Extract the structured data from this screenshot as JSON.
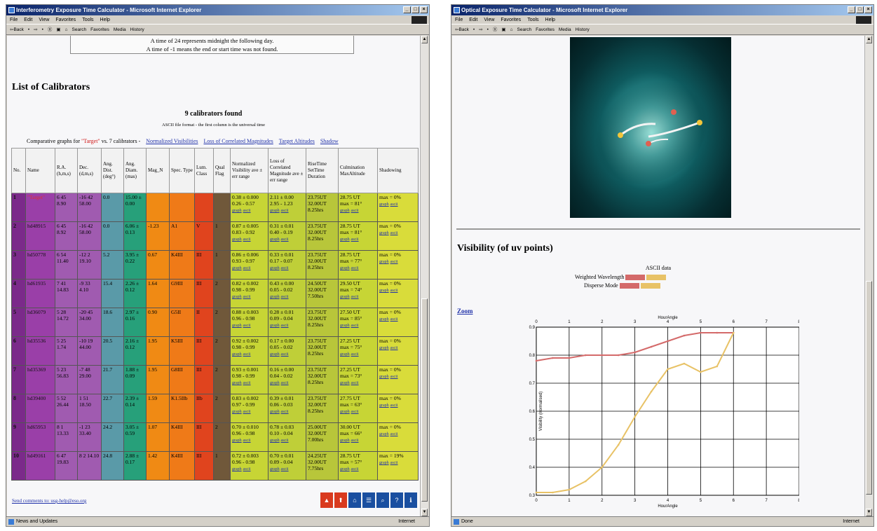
{
  "window1": {
    "title": "Interferometry Exposure Time Calculator - Microsoft Internet Explorer",
    "menu": [
      "File",
      "Edit",
      "View",
      "Favorites",
      "Tools",
      "Help"
    ],
    "toolbar": [
      "⇦Back",
      "•",
      "⇨",
      "•",
      "Ⓧ",
      "▣",
      "⌂",
      "Search",
      "Favorites",
      "Media",
      "History"
    ],
    "note_line1": "A time of 24 represents midnight the following day.",
    "note_line2": "A time of -1 means the end or start time was not found.",
    "section_title": "List of Calibrators",
    "calibrators_found": "9 calibrators found",
    "ascii_note": "ASCII file format - the first column is the universal time",
    "comparative_prefix": "Comparative graphs for",
    "target_name": "\"Target\"",
    "comparative_mid": "vs. 7 calibrators -",
    "links": [
      "Normalized Visibilities",
      "Loss of Correlated Magnitudes",
      "Target Altitudes",
      "Shadow"
    ],
    "columns": [
      "No.",
      "Name",
      "R.A. (h,m,s)",
      "Dec. (d,m,s)",
      "Ang. Dist. (deg°)",
      "Ang. Diam. (mas)",
      "Mag_N",
      "Spec. Type",
      "Lum. Class",
      "Qual Flag",
      "Normalized Visibility ave ± err range",
      "Loss of Correlated Magnitude ave ± err range",
      "RiseTime SetTime Duration",
      "Culmination MaxAltitude",
      "Shadowing"
    ],
    "rows": [
      {
        "no": "1",
        "name": "\"Target\"",
        "ra": "6 45 8.90",
        "dec": "-16 42 58.00",
        "dist": "0.0",
        "diam": "15.00 ± 0.00",
        "mag": "",
        "spec": "",
        "lum": "",
        "qual": "",
        "vis": "0.38 ± 0.000",
        "vis_range": "0.26 - 0.57",
        "loss": "2.11 ± 0.00",
        "loss_range": "2.95 - 1.23",
        "rise": "23.75UT",
        "set": "32.00UT",
        "dur": "8.25hrs",
        "cul": "28.75 UT",
        "maxalt": "max = 81°",
        "shad": "max = 0%"
      },
      {
        "no": "2",
        "name": "hd48915",
        "ra": "6 45 8.92",
        "dec": "-16 42 58.00",
        "dist": "0.0",
        "diam": "6.06 ± 0.13",
        "mag": "-1.23",
        "spec": "A1",
        "lum": "V",
        "qual": "1",
        "vis": "0.87 ± 0.005",
        "vis_range": "0.83 - 0.92",
        "loss": "0.31 ± 0.01",
        "loss_range": "0.40 - 0.19",
        "rise": "23.75UT",
        "set": "32.00UT",
        "dur": "8.25hrs",
        "cul": "28.75 UT",
        "maxalt": "max = 81°",
        "shad": "max = 0%"
      },
      {
        "no": "3",
        "name": "hd50778",
        "ra": "6 54 11.40",
        "dec": "-12 2 19.10",
        "dist": "5.2",
        "diam": "3.95 ± 0.22",
        "mag": "0.67",
        "spec": "K4III",
        "lum": "III",
        "qual": "1",
        "vis": "0.86 ± 0.006",
        "vis_range": "0.93 - 0.97",
        "loss": "0.33 ± 0.01",
        "loss_range": "0.17 - 0.07",
        "rise": "23.75UT",
        "set": "32.00UT",
        "dur": "8.25hrs",
        "cul": "28.75 UT",
        "maxalt": "max = 77°",
        "shad": "max = 0%"
      },
      {
        "no": "4",
        "name": "hd61935",
        "ra": "7 41 14.83",
        "dec": "-9 33 4.10",
        "dist": "15.4",
        "diam": "2.26 ± 0.12",
        "mag": "1.64",
        "spec": "G9III",
        "lum": "III",
        "qual": "2",
        "vis": "0.82 ± 0.002",
        "vis_range": "0.98 - 0.99",
        "loss": "0.43 ± 0.00",
        "loss_range": "0.05 - 0.02",
        "rise": "24.50UT",
        "set": "32.00UT",
        "dur": "7.50hrs",
        "cul": "29.50 UT",
        "maxalt": "max = 74°",
        "shad": "max = 0%"
      },
      {
        "no": "5",
        "name": "hd36079",
        "ra": "5 28 14.72",
        "dec": "-20 45 34.00",
        "dist": "18.6",
        "diam": "2.97 ± 0.16",
        "mag": "0.90",
        "spec": "G5II",
        "lum": "II",
        "qual": "2",
        "vis": "0.88 ± 0.003",
        "vis_range": "0.96 - 0.98",
        "loss": "0.28 ± 0.01",
        "loss_range": "0.09 - 0.04",
        "rise": "23.75UT",
        "set": "32.00UT",
        "dur": "8.25hrs",
        "cul": "27.50 UT",
        "maxalt": "max = 85°",
        "shad": "max = 0%"
      },
      {
        "no": "6",
        "name": "hd35536",
        "ra": "5 25 1.74",
        "dec": "-10 19 44.00",
        "dist": "20.5",
        "diam": "2.16 ± 0.12",
        "mag": "1.95",
        "spec": "K5III",
        "lum": "III",
        "qual": "2",
        "vis": "0.92 ± 0.002",
        "vis_range": "0.98 - 0.99",
        "loss": "0.17 ± 0.00",
        "loss_range": "0.05 - 0.02",
        "rise": "23.75UT",
        "set": "32.00UT",
        "dur": "8.25hrs",
        "cul": "27.25 UT",
        "maxalt": "max = 75°",
        "shad": "max = 0%"
      },
      {
        "no": "7",
        "name": "hd35369",
        "ra": "5 23 56.83",
        "dec": "-7 48 29.00",
        "dist": "21.7",
        "diam": "1.88 ± 0.09",
        "mag": "1.95",
        "spec": "G8III",
        "lum": "III",
        "qual": "2",
        "vis": "0.93 ± 0.001",
        "vis_range": "0.98 - 0.99",
        "loss": "0.16 ± 0.00",
        "loss_range": "0.04 - 0.02",
        "rise": "23.75UT",
        "set": "32.00UT",
        "dur": "8.25hrs",
        "cul": "27.25 UT",
        "maxalt": "max = 73°",
        "shad": "max = 0%"
      },
      {
        "no": "8",
        "name": "hd39400",
        "ra": "5 52 26.44",
        "dec": "1 51 18.50",
        "dist": "22.7",
        "diam": "2.39 ± 0.14",
        "mag": "1.59",
        "spec": "K1.5IIb",
        "lum": "IIb",
        "qual": "2",
        "vis": "0.83 ± 0.002",
        "vis_range": "0.97 - 0.99",
        "loss": "0.39 ± 0.01",
        "loss_range": "0.06 - 0.03",
        "rise": "23.75UT",
        "set": "32.00UT",
        "dur": "8.25hrs",
        "cul": "27.75 UT",
        "maxalt": "max = 63°",
        "shad": "max = 0%"
      },
      {
        "no": "9",
        "name": "hd65953",
        "ra": "8 1 13.33",
        "dec": "-1 23 33.40",
        "dist": "24.2",
        "diam": "3.05 ± 0.59",
        "mag": "1.07",
        "spec": "K4III",
        "lum": "III",
        "qual": "2",
        "vis": "0.70 ± 0.010",
        "vis_range": "0.96 - 0.98",
        "loss": "0.78 ± 0.03",
        "loss_range": "0.10 - 0.04",
        "rise": "25.00UT",
        "set": "32.00UT",
        "dur": "7.00hrs",
        "cul": "30.00 UT",
        "maxalt": "max = 66°",
        "shad": "max = 0%"
      },
      {
        "no": "10",
        "name": "hd49161",
        "ra": "6 47 19.83",
        "dec": "8 2 14.10",
        "dist": "24.8",
        "diam": "2.88 ± 0.17",
        "mag": "1.42",
        "spec": "K4III",
        "lum": "III",
        "qual": "1",
        "vis": "0.72 ± 0.003",
        "vis_range": "0.96 - 0.98",
        "loss": "0.70 ± 0.01",
        "loss_range": "0.09 - 0.04",
        "rise": "24.25UT",
        "set": "32.00UT",
        "dur": "7.75hrs",
        "cul": "28.75 UT",
        "maxalt": "max = 57°",
        "shad": "max = 19%"
      }
    ],
    "link_graph": "graph",
    "link_ascii": "ascii",
    "send_comments": "Send comments to: usg-help@eso.org",
    "status_left": "News and Updates",
    "status_right": "Internet"
  },
  "window2": {
    "title": "Optical Exposure Time Calculator - Microsoft Internet Explorer",
    "menu": [
      "File",
      "Edit",
      "View",
      "Favorites",
      "Tools",
      "Help"
    ],
    "toolbar": [
      "⇦Back",
      "•",
      "⇨",
      "•",
      "Ⓧ",
      "▣",
      "⌂",
      "Search",
      "Favorites",
      "Media",
      "History"
    ],
    "section_title": "Visibility (of uv points)",
    "ascii_data": "ASCII data",
    "weighted_wavelength": "Weighted Wavelength",
    "disperse_mode": "Disperse Mode",
    "zoom": "Zoom",
    "status_left": "Done",
    "status_right": "Internet",
    "chart_data": {
      "type": "line",
      "xlabel": "HourAngle",
      "ylabel": "Visibility (normalised)",
      "xlim": [
        0,
        8
      ],
      "ylim": [
        0.3,
        0.9
      ],
      "xticks": [
        0,
        1,
        2,
        3,
        4,
        5,
        6,
        7,
        8
      ],
      "yticks": [
        "0.3",
        "0.4",
        "0.5",
        "0.6",
        "0.7",
        "0.8",
        "0.9"
      ],
      "grid": true,
      "series": [
        {
          "color": "#d46a6a",
          "x": [
            0,
            0.5,
            1,
            1.5,
            2,
            2.5,
            3,
            3.5,
            4,
            4.5,
            5,
            5.5,
            6
          ],
          "y": [
            0.78,
            0.79,
            0.79,
            0.8,
            0.8,
            0.8,
            0.81,
            0.83,
            0.85,
            0.87,
            0.88,
            0.88,
            0.88
          ]
        },
        {
          "color": "#e8c266",
          "x": [
            0,
            0.5,
            1,
            1.5,
            2,
            2.5,
            3,
            3.5,
            4,
            4.5,
            5,
            5.5,
            6
          ],
          "y": [
            0.31,
            0.31,
            0.32,
            0.35,
            0.4,
            0.48,
            0.58,
            0.67,
            0.75,
            0.77,
            0.74,
            0.76,
            0.88
          ]
        }
      ]
    }
  }
}
